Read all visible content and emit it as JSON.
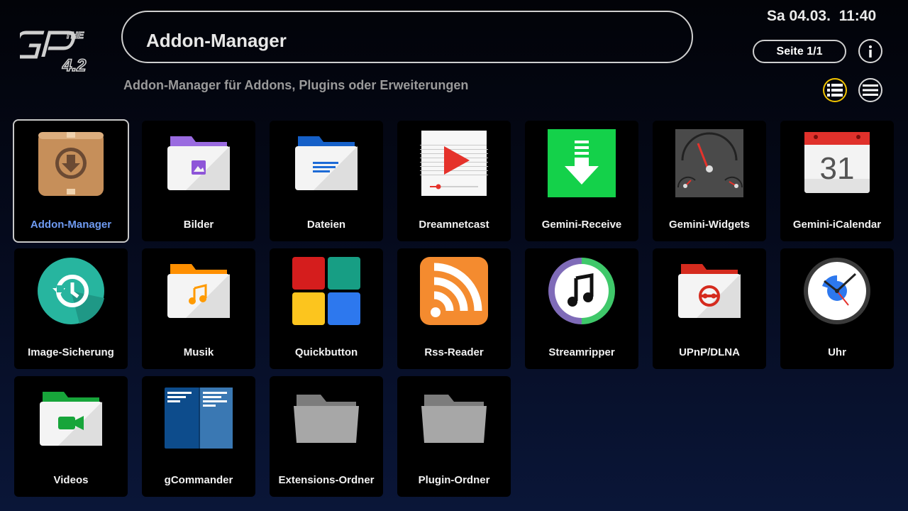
{
  "header": {
    "logo_text": "THE GP 4.2",
    "title": "Addon-Manager",
    "subtitle": "Addon-Manager für Addons, Plugins oder Erweiterungen",
    "datetime": "Sa 04.03.  11:40",
    "page_label": "Seite 1/1"
  },
  "toolbar": {
    "info_icon": "info-icon",
    "grid_view_icon": "list-view-icon",
    "menu_icon": "menu-icon",
    "active_color": "#f2c400"
  },
  "apps": [
    {
      "label": "Addon-Manager",
      "icon": "package-download-icon",
      "selected": true
    },
    {
      "label": "Bilder",
      "icon": "pictures-folder-icon"
    },
    {
      "label": "Dateien",
      "icon": "documents-folder-icon"
    },
    {
      "label": "Dreamnetcast",
      "icon": "video-player-icon"
    },
    {
      "label": "Gemini-Receive",
      "icon": "download-arrow-icon"
    },
    {
      "label": "Gemini-Widgets",
      "icon": "gauges-icon"
    },
    {
      "label": "Gemini-iCalendar",
      "icon": "calendar-icon",
      "calendar_day": "31"
    },
    {
      "label": "Image-Sicherung",
      "icon": "backup-restore-icon"
    },
    {
      "label": "Musik",
      "icon": "music-folder-icon"
    },
    {
      "label": "Quickbutton",
      "icon": "color-squares-icon"
    },
    {
      "label": "Rss-Reader",
      "icon": "rss-icon"
    },
    {
      "label": "Streamripper",
      "icon": "music-note-icon"
    },
    {
      "label": "UPnP/DLNA",
      "icon": "upnp-folder-icon"
    },
    {
      "label": "Uhr",
      "icon": "clock-icon"
    },
    {
      "label": "Videos",
      "icon": "videos-folder-icon"
    },
    {
      "label": "gCommander",
      "icon": "file-commander-icon"
    },
    {
      "label": "Extensions-Ordner",
      "icon": "grey-folder-icon"
    },
    {
      "label": "Plugin-Ordner",
      "icon": "grey-folder-icon"
    }
  ]
}
